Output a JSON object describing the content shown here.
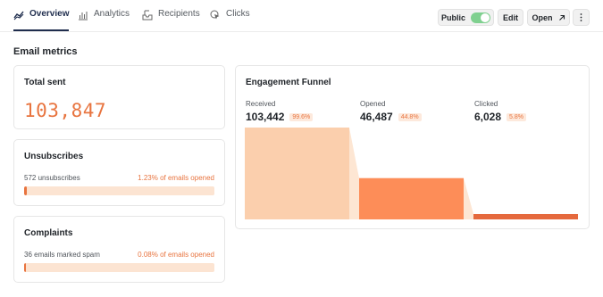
{
  "nav": {
    "tabs": [
      {
        "label": "Overview",
        "icon": "trend-icon",
        "active": true
      },
      {
        "label": "Analytics",
        "icon": "bar-chart-icon",
        "active": false
      },
      {
        "label": "Recipients",
        "icon": "inbox-icon",
        "active": false
      },
      {
        "label": "Clicks",
        "icon": "cursor-click-icon",
        "active": false
      }
    ],
    "public_label": "Public",
    "public_enabled": true,
    "edit_label": "Edit",
    "open_label": "Open",
    "more_icon": "more-vertical-icon"
  },
  "section_title": "Email metrics",
  "total_sent": {
    "title": "Total sent",
    "value": "103,847"
  },
  "unsubscribes": {
    "title": "Unsubscribes",
    "count_text": "572 unsubscribes",
    "rate_text": "1.23% of emails opened",
    "rate": 1.23
  },
  "complaints": {
    "title": "Complaints",
    "count_text": "36 emails marked spam",
    "rate_text": "0.08% of emails opened",
    "rate": 0.08
  },
  "funnel": {
    "title": "Engagement Funnel",
    "colors": [
      "#fbcfad",
      "#fd8d58",
      "#e5693d"
    ],
    "stages": [
      {
        "label": "Received",
        "value": "103,442",
        "pct": "99.6%",
        "count": 103442
      },
      {
        "label": "Opened",
        "value": "46,487",
        "pct": "44.8%",
        "count": 46487
      },
      {
        "label": "Clicked",
        "value": "6,028",
        "pct": "5.8%",
        "count": 6028
      }
    ]
  }
}
